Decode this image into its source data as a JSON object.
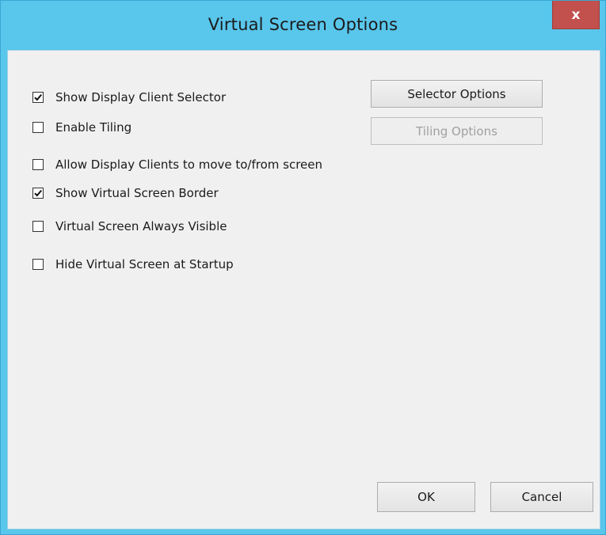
{
  "window": {
    "title": "Virtual Screen Options",
    "close_label": "x"
  },
  "options": [
    {
      "label": "Show Display Client Selector",
      "checked": true
    },
    {
      "label": "Enable Tiling",
      "checked": false
    },
    {
      "label": "Allow Display Clients to move to/from screen",
      "checked": false
    },
    {
      "label": "Show Virtual Screen Border",
      "checked": true
    },
    {
      "label": "Virtual Screen Always Visible",
      "checked": false
    },
    {
      "label": "Hide Virtual Screen at Startup",
      "checked": false
    }
  ],
  "buttons": {
    "selector_options": "Selector Options",
    "tiling_options": "Tiling Options",
    "ok": "OK",
    "cancel": "Cancel"
  },
  "colors": {
    "titlebar": "#59c6ec",
    "close": "#c2504c",
    "client": "#f0f0f0"
  }
}
